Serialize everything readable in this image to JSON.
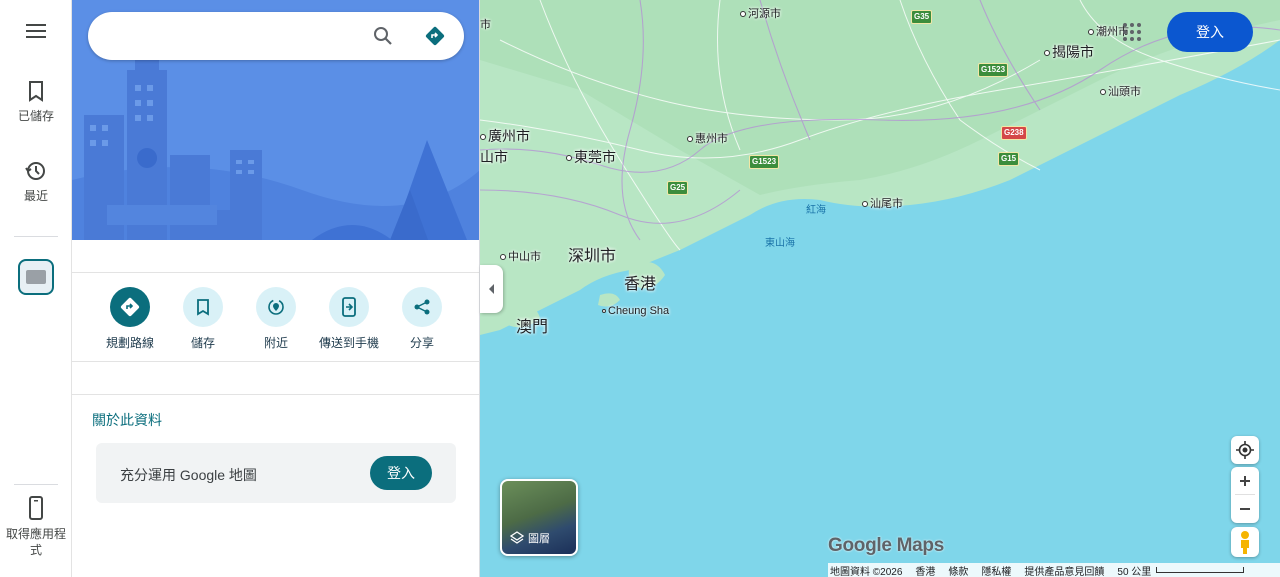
{
  "rail": {
    "menu_icon": "hamburger-menu-icon",
    "saved_label": "已儲存",
    "recent_label": "最近",
    "get_app_label": "取得應用程式"
  },
  "search": {
    "value": "",
    "placeholder": ""
  },
  "actions": [
    {
      "label": "規劃路線",
      "icon": "directions-icon"
    },
    {
      "label": "儲存",
      "icon": "bookmark-icon"
    },
    {
      "label": "附近",
      "icon": "nearby-icon"
    },
    {
      "label": "傳送到手機",
      "icon": "send-to-phone-icon"
    },
    {
      "label": "分享",
      "icon": "share-icon"
    }
  ],
  "about": {
    "heading": "關於此資料",
    "promo_text": "充分運用 Google 地圖",
    "signin_label": "登入"
  },
  "map": {
    "signin_label": "登入",
    "layers_label": "圖層",
    "logo": "Google Maps",
    "places": {
      "heyuan": "河源市",
      "chaozhou": "潮州市",
      "jieyang": "揭陽市",
      "shantou": "汕頭市",
      "guangzhou": "廣州市",
      "foshan_partial": "山市",
      "partial_top": "市",
      "dongguan": "東莞市",
      "huizhou": "惠州市",
      "shanwei": "汕尾市",
      "honghai": "紅海",
      "dongshanhai": "東山海",
      "zhongshan": "中山市",
      "shenzhen": "深圳市",
      "hongkong": "香港",
      "macau": "澳門",
      "cheungsha": "Cheung Sha"
    },
    "shields": [
      "G35",
      "G1523",
      "G238",
      "G1523",
      "G15",
      "G25"
    ],
    "footer": {
      "data": "地圖資料 ©2026",
      "region": "香港",
      "terms": "條款",
      "privacy": "隱私權",
      "feedback": "提供產品意見回饋",
      "scale": "50 公里"
    }
  },
  "colors": {
    "accent": "#0b6e7d",
    "signin_blue": "#0b57d0",
    "water": "#7fd6ea",
    "land": "#b8e6c4",
    "hero": "#5b8fe6"
  }
}
